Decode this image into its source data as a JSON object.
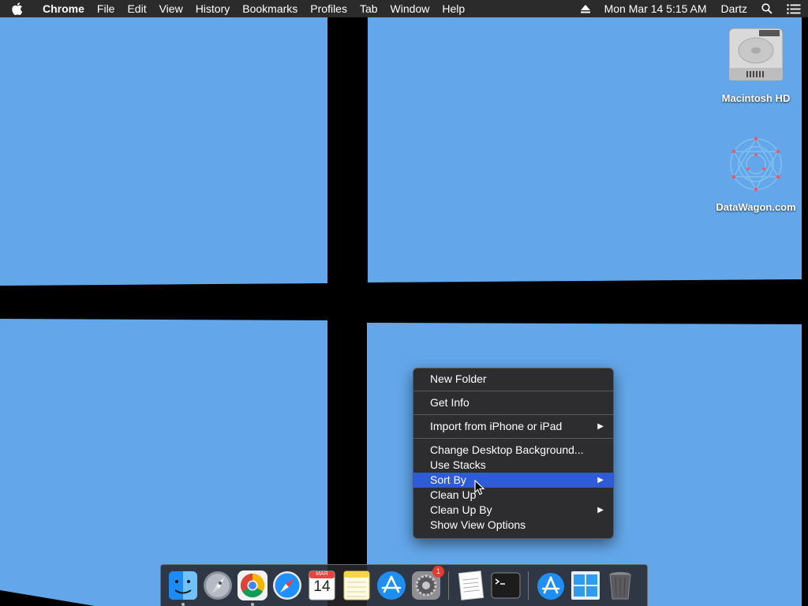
{
  "menubar": {
    "app_name": "Chrome",
    "menus": [
      "File",
      "Edit",
      "View",
      "History",
      "Bookmarks",
      "Profiles",
      "Tab",
      "Window",
      "Help"
    ],
    "clock": "Mon Mar 14  5:15 AM",
    "user": "Dartz"
  },
  "desktop": {
    "icons": [
      {
        "label": "Macintosh HD",
        "icon": "hard-drive-icon"
      },
      {
        "label": "DataWagon.com",
        "icon": "network-volume-icon"
      }
    ],
    "wallpaper_color": "#63a7ea"
  },
  "context_menu": {
    "items": [
      {
        "label": "New Folder"
      },
      {
        "label": "Get Info"
      },
      {
        "label": "Import from iPhone or iPad",
        "submenu": true
      },
      {
        "label": "Change Desktop Background..."
      },
      {
        "label": "Use Stacks"
      },
      {
        "label": "Sort By",
        "submenu": true,
        "highlighted": true
      },
      {
        "label": "Clean Up"
      },
      {
        "label": "Clean Up By",
        "submenu": true
      },
      {
        "label": "Show View Options"
      }
    ],
    "submenu_arrow": "▶",
    "highlight_color": "#2f5bd6"
  },
  "dock": {
    "calendar_month": "MAR",
    "calendar_day": "14",
    "system_prefs_badge": "1",
    "apps": [
      "finder-icon",
      "launchpad-icon",
      "chrome-icon",
      "safari-icon",
      "calendar-icon",
      "notes-icon",
      "app-store-icon",
      "system-preferences-icon",
      "textedit-icon",
      "terminal-icon",
      "app-store-download-icon",
      "windows-icon",
      "trash-icon"
    ]
  }
}
